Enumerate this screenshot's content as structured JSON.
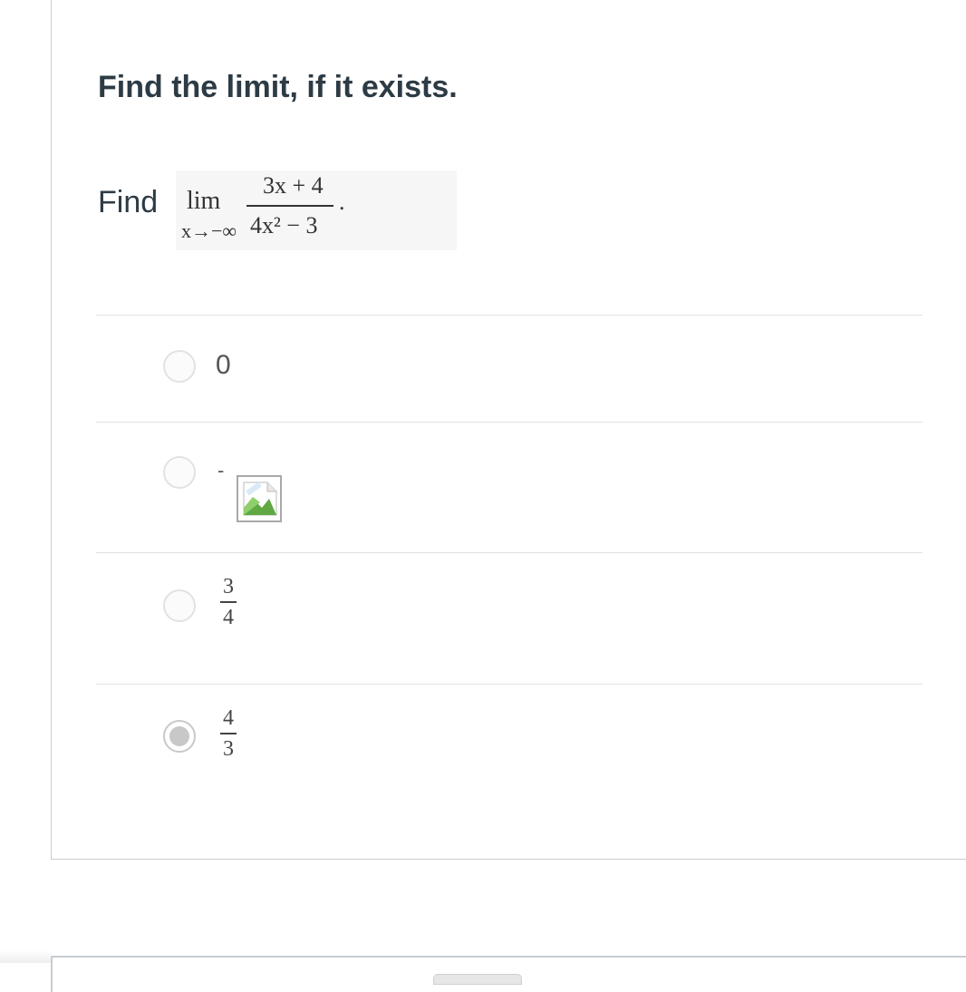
{
  "question": {
    "heading": "Find the limit, if it exists.",
    "find_word": "Find",
    "formula": {
      "lim": "lim",
      "subscript": "x→−∞",
      "numerator": "3x + 4",
      "denominator": "4x² − 3",
      "period": "."
    }
  },
  "answers": [
    {
      "label": "0",
      "selected": false
    },
    {
      "label": "-",
      "image": "broken-image-icon",
      "selected": false
    },
    {
      "numerator": "3",
      "denominator": "4",
      "selected": false
    },
    {
      "numerator": "4",
      "denominator": "3",
      "selected": true
    }
  ]
}
